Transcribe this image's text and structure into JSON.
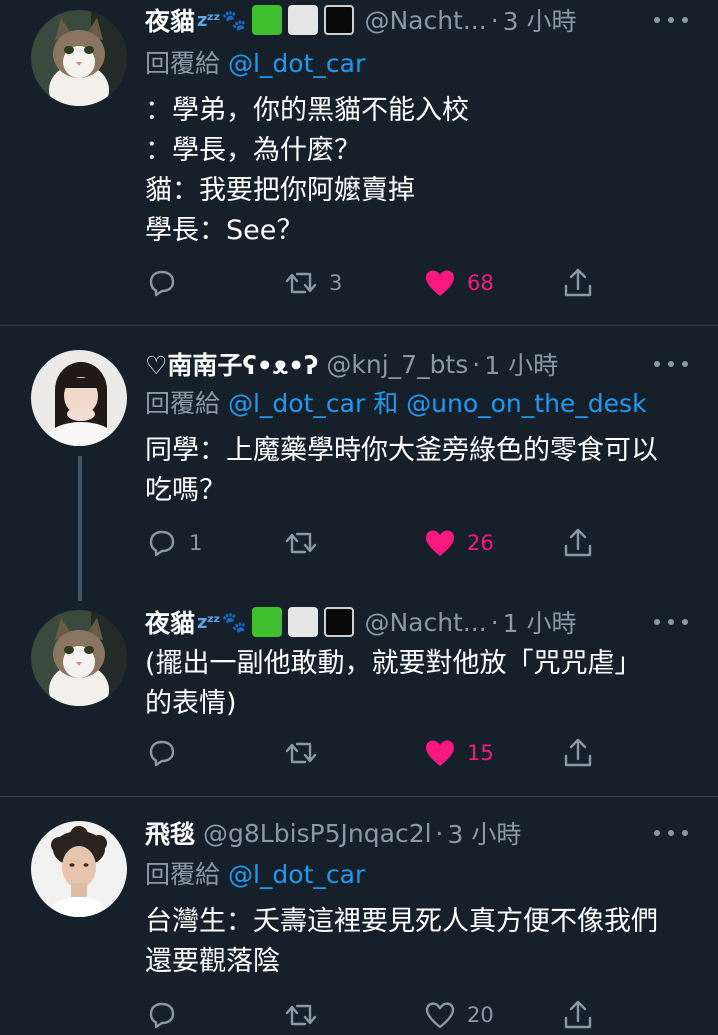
{
  "theme": {
    "background": "#15202b",
    "text": "#ffffff",
    "secondary": "#8b98a5",
    "link": "#1d9bf0",
    "like": "#f91880",
    "divider": "#38444d"
  },
  "tweets": [
    {
      "display_name": "夜貓",
      "handle": "@Nacht...",
      "time": "3 小時",
      "reply_prefix": "回覆給",
      "reply_mentions": [
        "@l_dot_car"
      ],
      "text": "：學弟，你的黑貓不能入校\n：學長，為什麼？\n貓：我要把你阿嬤賣掉\n學長：See？",
      "reply_count": "",
      "retweet_count": "3",
      "like_count": "68",
      "liked": true,
      "avatar": "cat-avatar"
    },
    {
      "display_name": "♡南南子ʕ•ᴥ•ʔ",
      "handle": "@knj_7_bts",
      "time": "1 小時",
      "reply_prefix": "回覆給",
      "reply_mentions": [
        "@l_dot_car",
        "@uno_on_the_desk"
      ],
      "reply_joiner": "和",
      "text": "同學：上魔藥學時你大釜旁綠色的零食可以吃嗎？",
      "reply_count": "1",
      "retweet_count": "",
      "like_count": "26",
      "liked": true,
      "avatar": "girl-avatar"
    },
    {
      "display_name": "夜貓",
      "handle": "@Nacht...",
      "time": "1 小時",
      "text": "(擺出一副他敢動，就要對他放「咒咒虐」的表情)",
      "reply_count": "",
      "retweet_count": "",
      "like_count": "15",
      "liked": true,
      "avatar": "cat-avatar"
    },
    {
      "display_name": "飛毯",
      "handle": "@g8LbisP5Jnqac2l",
      "time": "3 小時",
      "reply_prefix": "回覆給",
      "reply_mentions": [
        "@l_dot_car"
      ],
      "text": "台灣生：夭壽這裡要見死人真方便不像我們還要觀落陰",
      "reply_count": "",
      "retweet_count": "",
      "like_count": "20",
      "liked": false,
      "avatar": "man-avatar"
    }
  ]
}
